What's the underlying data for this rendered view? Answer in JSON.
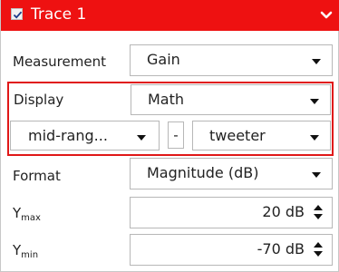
{
  "trace": {
    "title": "Trace 1",
    "checked": true,
    "header_color": "#ee1111"
  },
  "measurement": {
    "label": "Measurement",
    "value": "Gain"
  },
  "display": {
    "label": "Display",
    "value": "Math",
    "operand_a": "mid-rang...",
    "operator": "-",
    "operand_b": "tweeter",
    "highlight_color": "#e01818"
  },
  "format": {
    "label": "Format",
    "value": "Magnitude (dB)"
  },
  "ymax": {
    "label_main": "Y",
    "label_sub": "max",
    "value": "20 dB"
  },
  "ymin": {
    "label_main": "Y",
    "label_sub": "min",
    "value": "-70 dB"
  },
  "icons": {
    "check": "check-icon",
    "chevron": "chevron-down-icon",
    "dropdown_caret": "caret-down-icon",
    "spinner": "spinner-icon"
  }
}
